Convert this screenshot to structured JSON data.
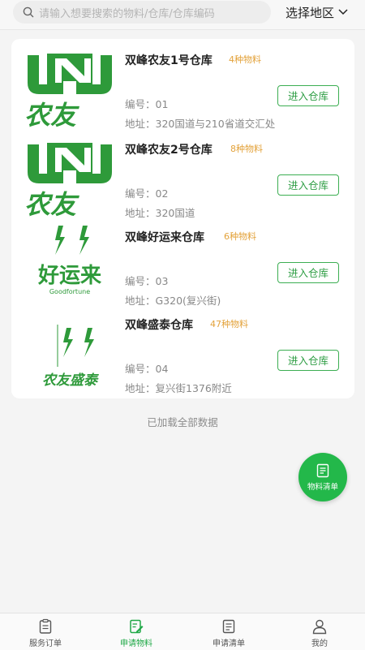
{
  "search": {
    "placeholder": "请输入想要搜索的物料/仓库/仓库编码"
  },
  "region": {
    "label": "选择地区"
  },
  "warehouses": [
    {
      "name": "双峰农友1号仓库",
      "count": "4种物料",
      "code": "编号：01",
      "address": "地址：320国道与210省道交汇处",
      "button": "进入仓库",
      "logo": "nongyou-logo",
      "logo_text": "农友"
    },
    {
      "name": "双峰农友2号仓库",
      "count": "8种物料",
      "code": "编号：02",
      "address": "地址：320国道",
      "button": "进入仓库",
      "logo": "nongyou-logo",
      "logo_text": "农友"
    },
    {
      "name": "双峰好运来仓库",
      "count": "6种物料",
      "code": "编号：03",
      "address": "地址：G320(复兴街)",
      "button": "进入仓库",
      "logo": "haoyunlai-logo",
      "logo_text": "好运来",
      "logo_subtext": "Goodfortune"
    },
    {
      "name": "双峰盛泰仓库",
      "count": "47种物料",
      "code": "编号：04",
      "address": "地址：复兴街1376附近",
      "button": "进入仓库",
      "logo": "nongyou-shengtai-logo",
      "logo_text": "农友盛泰"
    }
  ],
  "status": {
    "loaded": "已加载全部数据"
  },
  "fab": {
    "label": "物料清单"
  },
  "tabs": [
    {
      "label": "服务订单",
      "icon": "clipboard-icon",
      "active": false
    },
    {
      "label": "申请物料",
      "icon": "edit-document-icon",
      "active": true
    },
    {
      "label": "申请清单",
      "icon": "list-document-icon",
      "active": false
    },
    {
      "label": "我的",
      "icon": "user-icon",
      "active": false
    }
  ],
  "colors": {
    "accent": "#23b84a",
    "count": "#e3a23a",
    "logo_green": "#2e9a3a"
  }
}
